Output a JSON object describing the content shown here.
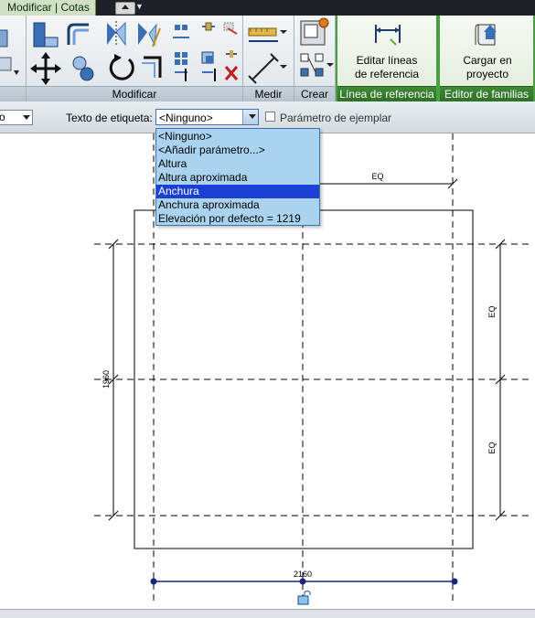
{
  "ribbon_tab": {
    "active": "Modificar | Cotas"
  },
  "panels": {
    "modificar": "Modificar",
    "medir": "Medir",
    "crear": "Crear",
    "linea_referencia": "Línea de referencia",
    "editor_familias": "Editor de familias"
  },
  "buttons": {
    "editar_lineas": "Editar líneas de referencia",
    "editar_lineas_l1": "Editar líneas",
    "editar_lineas_l2": "de referencia",
    "cargar_l1": "Cargar en",
    "cargar_l2": "proyecto"
  },
  "options_bar": {
    "left_combo_value": "o",
    "label_text_label": "Texto de etiqueta:",
    "label_value": "<Ninguno>",
    "instance_param_label": "Parámetro de ejemplar",
    "instance_param_checked": false
  },
  "dropdown": {
    "options": [
      "<Ninguno>",
      "<Añadir parámetro...>",
      "Altura",
      "Altura aproximada",
      "Anchura",
      "Anchura aproximada",
      "Elevación por defecto = 1219"
    ],
    "selected": "Anchura"
  },
  "drawing": {
    "dim_top": "EQ",
    "dim_right_top": "EQ",
    "dim_right_bottom": "EQ",
    "dim_left": "1960",
    "dim_bottom": "2160"
  },
  "colors": {
    "ribbon_bg": "#e4e9ee",
    "green_panel": "#3f8a35",
    "dropdown_bg": "#a9d3ee",
    "selection": "#1c3fd6",
    "dimension_line": "#1a237e"
  }
}
